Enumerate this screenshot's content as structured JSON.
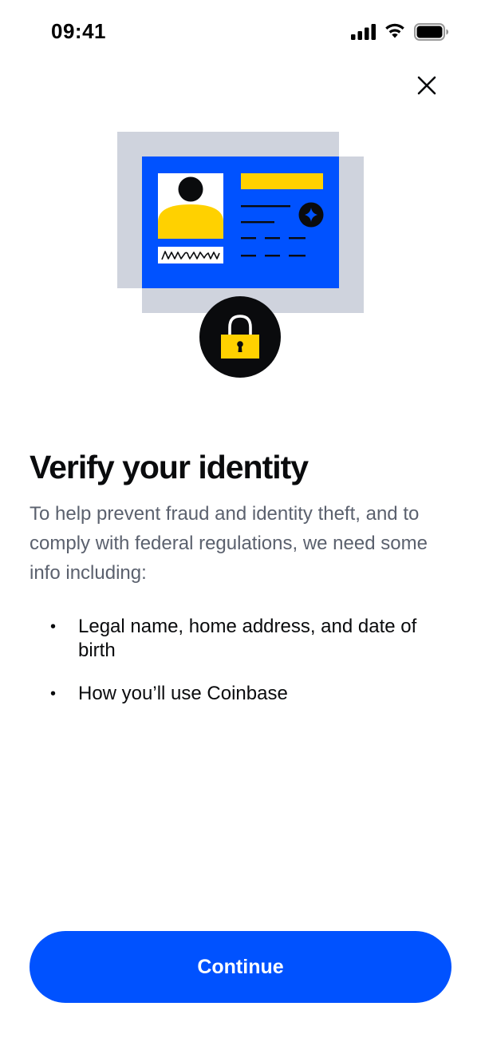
{
  "status_bar": {
    "time": "09:41"
  },
  "header": {
    "close_icon": "close-icon"
  },
  "illustration": {
    "icon_names": [
      "id-card-icon",
      "avatar-icon",
      "signature-icon",
      "badge-icon",
      "padlock-icon"
    ],
    "colors": {
      "card_blue": "#0052ff",
      "shadow_gray": "#cfd3dd",
      "yellow": "#ffd100",
      "black": "#0a0b0d"
    }
  },
  "content": {
    "title": "Verify your identity",
    "description": "To help prevent fraud and identity theft, and to comply with federal regulations, we need some info including:",
    "list_items": [
      {
        "bullet": "•",
        "text": "Legal name, home address, and date of birth"
      },
      {
        "bullet": "•",
        "text": "How you’ll use Coinbase"
      }
    ]
  },
  "actions": {
    "continue_label": "Continue"
  },
  "colors": {
    "accent": "#0052ff",
    "title_text": "#0a0b0d",
    "body_text": "#5b616e"
  }
}
